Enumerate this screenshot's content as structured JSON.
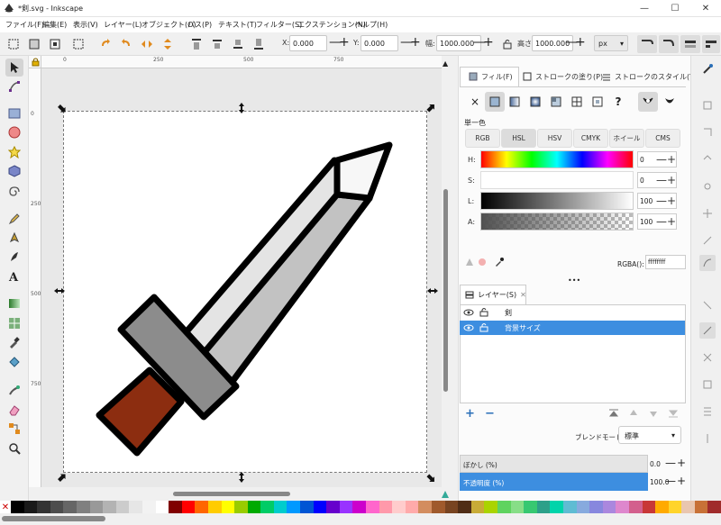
{
  "window": {
    "title": "*剣.svg - Inkscape"
  },
  "menu": [
    "ファイル(F)",
    "編集(E)",
    "表示(V)",
    "レイヤー(L)",
    "オブジェクト(O)",
    "パス(P)",
    "テキスト(T)",
    "フィルター(S)",
    "エクステンション(N)",
    "ヘルプ(H)"
  ],
  "toolbar": {
    "x_label": "X:",
    "x_value": "0.000",
    "y_label": "Y:",
    "y_value": "0.000",
    "w_label": "幅:",
    "w_value": "1000.000",
    "h_label": "高さ:",
    "h_value": "1000.000",
    "unit": "px"
  },
  "ruler": {
    "top": [
      "0",
      "250",
      "500",
      "750"
    ],
    "left": [
      "0",
      "250",
      "500",
      "750"
    ]
  },
  "fill_panel": {
    "tabs": [
      "フィル(F)",
      "ストロークの塗り(P)",
      "ストロークのスタイル(Y)"
    ],
    "close_glyph": "×",
    "unknown_glyph": "?",
    "mode_label": "単一色",
    "color_modes": [
      "RGB",
      "HSL",
      "HSV",
      "CMYK",
      "ホイール",
      "CMS"
    ],
    "active_mode": "HSL",
    "sliders": [
      {
        "label": "H:",
        "value": "0"
      },
      {
        "label": "S:",
        "value": "0"
      },
      {
        "label": "L:",
        "value": "100"
      },
      {
        "label": "A:",
        "value": "100"
      }
    ],
    "rgba_label": "RGBA():",
    "rgba_value": "ffffffff"
  },
  "layers_panel": {
    "tab": "レイヤー(S)",
    "layers": [
      {
        "name": "剣",
        "selected": false
      },
      {
        "name": "背景サイズ",
        "selected": true
      }
    ],
    "blend_label": "ブレンドモード:",
    "blend_value": "標準",
    "blur_label": "ぼかし (%)",
    "blur_value": "0.0",
    "opacity_label": "不透明度 (%)",
    "opacity_value": "100.0"
  },
  "palette": [
    "#000000",
    "#1a1a1a",
    "#333333",
    "#4d4d4d",
    "#666666",
    "#808080",
    "#999999",
    "#b3b3b3",
    "#cccccc",
    "#e6e6e6",
    "#f2f2f2",
    "#ffffff",
    "#800000",
    "#ff0000",
    "#ff6600",
    "#ffcc00",
    "#ffff00",
    "#99cc00",
    "#00aa00",
    "#00cc66",
    "#00cccc",
    "#0099ff",
    "#0055d4",
    "#0000ff",
    "#6600cc",
    "#9933ff",
    "#cc00cc",
    "#ff66cc",
    "#ff99aa",
    "#ffcccc",
    "#ffaaaa",
    "#d38d5f",
    "#a05a2c",
    "#784421",
    "#502d16",
    "#c8ab37",
    "#aad400",
    "#5fd35f",
    "#87de87",
    "#37c871",
    "#2ca089",
    "#00d4aa",
    "#5fbcd3",
    "#87aade",
    "#8787de",
    "#aa87de",
    "#de87cd",
    "#d35f8d",
    "#c83737",
    "#ffaa00",
    "#ffd42a",
    "#e9c6af",
    "#c87137",
    "#a02c2c"
  ]
}
